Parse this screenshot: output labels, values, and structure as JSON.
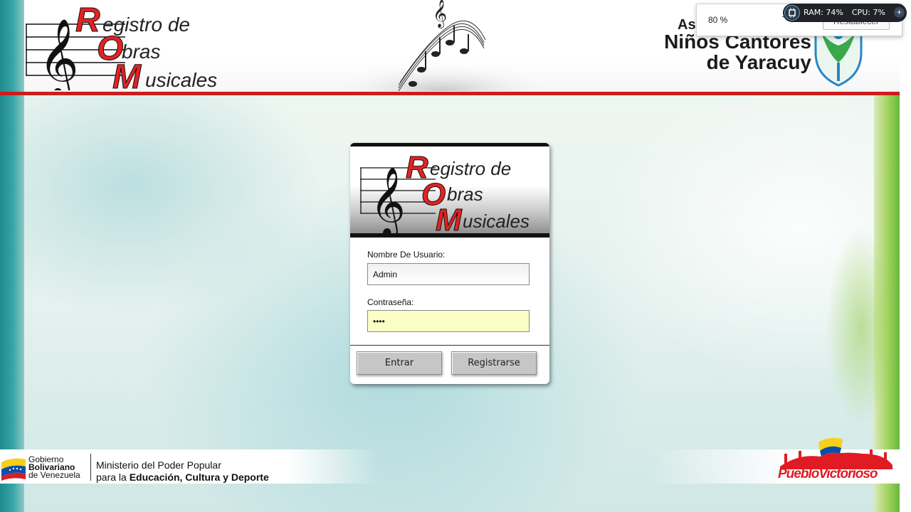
{
  "header": {
    "rom_logo": {
      "line1": "Registro de",
      "line2": "Obras",
      "line3": "Musicales",
      "big_letters": [
        "R",
        "O",
        "M"
      ],
      "rest1": "egistro de",
      "rest2": "bras",
      "rest3": "usicales"
    },
    "association_line1": "As",
    "association_line2": "Niños Cantores",
    "association_line3": "de Yaracuy"
  },
  "zoom_popup": {
    "value": "80 %",
    "minus_label": "−",
    "reset_label": "Restablecer"
  },
  "system_widget": {
    "ram": "RAM: 74%",
    "cpu": "CPU: 7%",
    "plus_label": "+"
  },
  "login": {
    "logo": {
      "rest1": "egistro de",
      "rest2": "bras",
      "rest3": "usicales"
    },
    "username_label": "Nombre De Usuario:",
    "username_value": "Admin",
    "password_label": "Contraseña:",
    "password_value": "••••",
    "enter_button": "Entrar",
    "register_button": "Registrarse"
  },
  "footer": {
    "gob_line1": "Gobierno",
    "gob_line2": "Bolivariano",
    "gob_line3": "de Venezuela",
    "ministry_line1": "Ministerio del Poder Popular",
    "ministry_line2_prefix": "para la ",
    "ministry_line2_bold": "Educación, Cultura y Deporte",
    "pueblo": "PuebloVictorioso"
  },
  "colors": {
    "accent_red": "#cc1d1d",
    "password_bg": "#fbffc6",
    "shield_green": "#3aa84a",
    "shield_blue": "#2a86c6"
  }
}
